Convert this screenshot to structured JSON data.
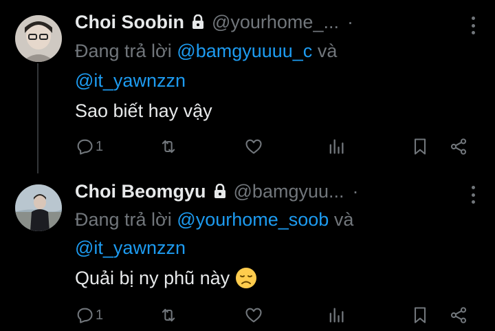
{
  "tweets": [
    {
      "name": "Choi Soobin",
      "handle": "@yourhome_...",
      "separator": "·",
      "reply_prefix": "Đang trả lời",
      "mention1": "@bamgyuuuu_c",
      "conjunction": "và",
      "mention2": "@it_yawnzzn",
      "text": "Sao biết hay vậy",
      "reply_count": "1",
      "emoji": ""
    },
    {
      "name": "Choi Beomgyu",
      "handle": "@bamgyuu...",
      "separator": "·",
      "reply_prefix": "Đang trả lời",
      "mention1": "@yourhome_soob",
      "conjunction": "và",
      "mention2": "@it_yawnzzn",
      "text": "Quải bị ny phũ này",
      "reply_count": "1",
      "emoji": "disappointed-face"
    }
  ],
  "icons": {
    "lock": "lock-icon",
    "reply": "reply-icon",
    "retweet": "retweet-icon",
    "like": "heart-icon",
    "views": "views-icon",
    "bookmark": "bookmark-icon",
    "share": "share-icon",
    "more": "more-icon"
  },
  "colors": {
    "background": "#000000",
    "text": "#e7e9ea",
    "muted": "#71767b",
    "mention": "#1d9bf0"
  }
}
